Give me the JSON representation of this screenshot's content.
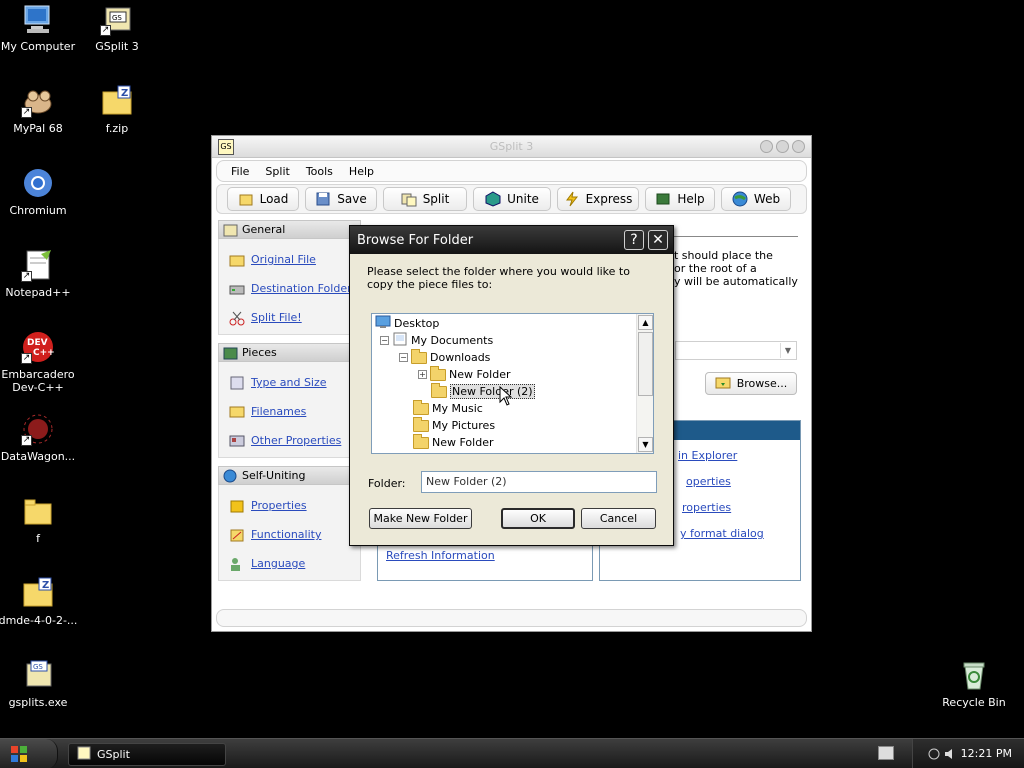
{
  "desktop": {
    "icons": [
      {
        "label": "My Computer"
      },
      {
        "label": "GSplit 3"
      },
      {
        "label": "MyPal 68"
      },
      {
        "label": "f.zip"
      },
      {
        "label": "Chromium"
      },
      {
        "label": "Notepad++"
      },
      {
        "label": "Embarcadero Dev-C++"
      },
      {
        "label": "DataWagon..."
      },
      {
        "label": "f"
      },
      {
        "label": "dmde-4-0-2-..."
      },
      {
        "label": "gsplits.exe"
      },
      {
        "label": "Recycle Bin"
      }
    ]
  },
  "gsplit": {
    "title": "GSplit 3",
    "menu": [
      "File",
      "Split",
      "Tools",
      "Help"
    ],
    "toolbar": [
      "Load",
      "Save",
      "Split",
      "Unite",
      "Express",
      "Help",
      "Web"
    ],
    "sections": [
      {
        "header": "General",
        "items": [
          "Original File",
          "Destination Folder",
          "Split File!"
        ]
      },
      {
        "header": "Pieces",
        "items": [
          "Type and Size",
          "Filenames",
          "Other Properties"
        ]
      },
      {
        "header": "Self-Uniting",
        "items": [
          "Properties",
          "Functionality",
          "Language"
        ]
      }
    ],
    "content_text_lines": [
      "t should place the",
      "or the root of a",
      "y will be automatically"
    ],
    "browse_label": "Browse...",
    "right_links": [
      "in Explorer",
      "operties",
      "roperties",
      "y format dialog"
    ],
    "left_link": "Refresh Information"
  },
  "dialog": {
    "title": "Browse For Folder",
    "help_btn": "?",
    "close_btn": "✕",
    "prompt": "Please select the folder where you would like to copy the piece files to:",
    "tree": {
      "desktop": "Desktop",
      "my_documents": "My Documents",
      "downloads": "Downloads",
      "new_folder_1": "New Folder",
      "new_folder_2": "New Folder (2)",
      "my_music": "My Music",
      "my_pictures": "My Pictures",
      "new_folder_3": "New Folder"
    },
    "folder_label": "Folder:",
    "folder_value": "New Folder (2)",
    "make_new_folder": "Make New Folder",
    "ok": "OK",
    "cancel": "Cancel"
  },
  "taskbar": {
    "task": "GSplit",
    "clock": "12:21 PM"
  }
}
